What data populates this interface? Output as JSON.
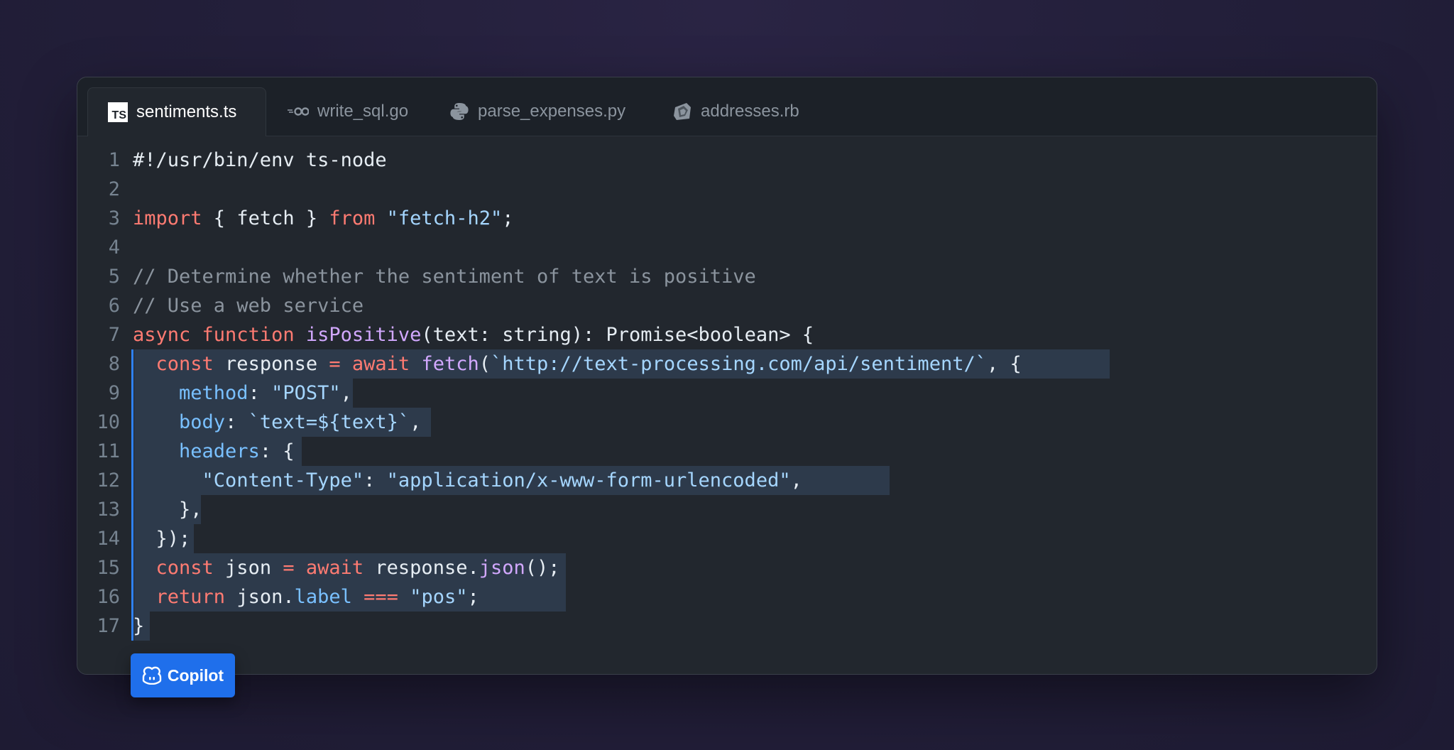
{
  "tabs": [
    {
      "label": "sentiments.ts",
      "icon": "typescript-icon",
      "icon_text": "TS",
      "active": true
    },
    {
      "label": "write_sql.go",
      "icon": "go-icon",
      "active": false
    },
    {
      "label": "parse_expenses.py",
      "icon": "python-icon",
      "active": false
    },
    {
      "label": "addresses.rb",
      "icon": "ruby-icon",
      "active": false
    }
  ],
  "lines": [
    {
      "n": "1",
      "html": "#!/usr/bin/env ts-node"
    },
    {
      "n": "2",
      "html": ""
    },
    {
      "n": "3",
      "html": "<span class=\"k\">import</span> { fetch } <span class=\"k\">from</span> <span class=\"s\">\"fetch-h2\"</span>;"
    },
    {
      "n": "4",
      "html": ""
    },
    {
      "n": "5",
      "html": "<span class=\"c\">// Determine whether the sentiment of text is positive</span>"
    },
    {
      "n": "6",
      "html": "<span class=\"c\">// Use a web service</span>"
    },
    {
      "n": "7",
      "html": "<span class=\"k\">async</span> <span class=\"k\">function</span> <span class=\"f\">isPositive</span>(text: string): Promise&lt;boolean&gt; {"
    },
    {
      "n": "8",
      "html": "  <span class=\"k\">const</span> response <span class=\"k\">=</span> <span class=\"k\">await</span> <span class=\"f\">fetch</span>(<span class=\"s\">`http://text-processing.com/api/sentiment/`</span>, {"
    },
    {
      "n": "9",
      "html": "    <span class=\"p\">method</span>: <span class=\"s\">\"POST\"</span>,"
    },
    {
      "n": "10",
      "html": "    <span class=\"p\">body</span>: <span class=\"s\">`text=${text}`</span>,"
    },
    {
      "n": "11",
      "html": "    <span class=\"p\">headers</span>: {"
    },
    {
      "n": "12",
      "html": "      <span class=\"s\">\"Content-Type\"</span>: <span class=\"s\">\"application/x-www-form-urlencoded\"</span>,"
    },
    {
      "n": "13",
      "html": "    },"
    },
    {
      "n": "14",
      "html": "  });"
    },
    {
      "n": "15",
      "html": "  <span class=\"k\">const</span> json <span class=\"k\">=</span> <span class=\"k\">await</span> response.<span class=\"f\">json</span>();"
    },
    {
      "n": "16",
      "html": "  <span class=\"k\">return</span> json.<span class=\"p\">label</span> <span class=\"k\">===</span> <span class=\"s\">\"pos\"</span>;"
    },
    {
      "n": "17",
      "html": "}"
    }
  ],
  "copilot": {
    "label": "Copilot",
    "icon": "copilot-icon"
  },
  "colors": {
    "keyword": "#ff7b72",
    "string": "#a5d6ff",
    "comment": "#8b949e",
    "function": "#d2a8ff",
    "property": "#79c0ff",
    "suggestion_highlight": "#2d3a4b",
    "accent": "#1f6feb"
  }
}
